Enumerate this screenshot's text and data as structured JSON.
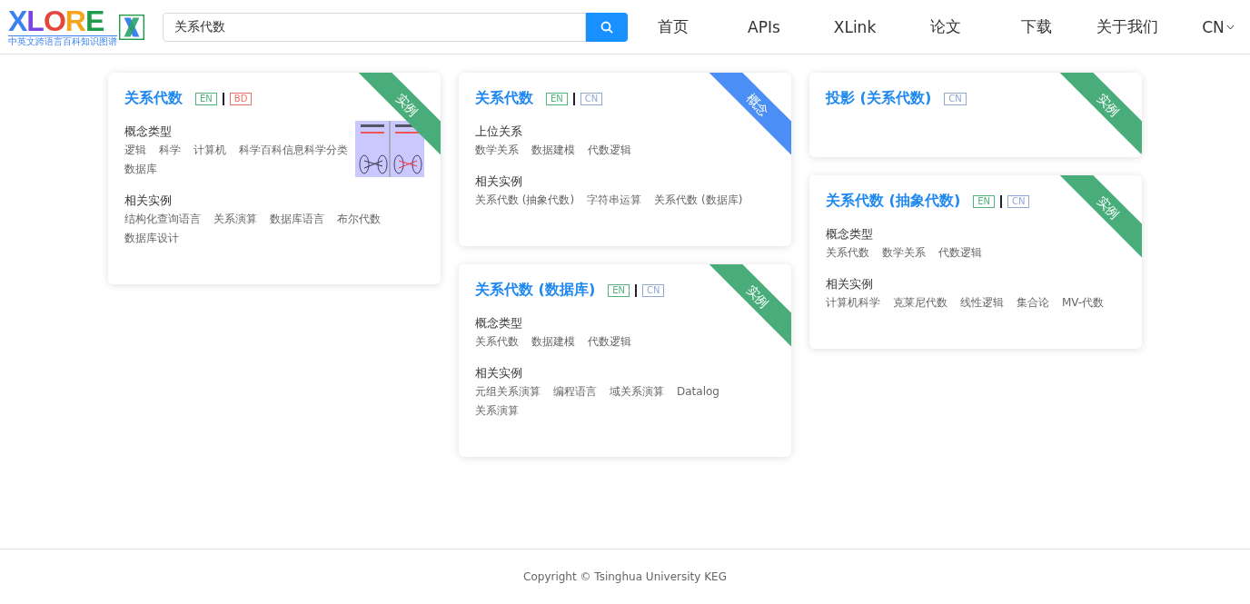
{
  "header": {
    "logo": {
      "text": "XLORE",
      "subtitle": "中英文跨语言百科知识图谱"
    },
    "search": {
      "value": "关系代数"
    },
    "nav": [
      {
        "label": "首页"
      },
      {
        "label": "APIs"
      },
      {
        "label": "XLink"
      },
      {
        "label": "论文"
      },
      {
        "label": "下载"
      },
      {
        "label": "关于我们"
      },
      {
        "label": "CN",
        "kind": "dropdown"
      }
    ]
  },
  "columns": [
    [
      {
        "title": "关系代数",
        "tags": [
          {
            "label": "EN",
            "color": "#52b47a"
          },
          {
            "label": "BD",
            "color": "#e8706a"
          }
        ],
        "ribbon": {
          "label": "实例",
          "color": "#48ad7a"
        },
        "image": {
          "kind": "picture"
        },
        "sections": [
          {
            "heading": "概念类型",
            "items": [
              "逻辑",
              "科学",
              "计算机",
              "科学百科信息科学分类",
              "数据库"
            ]
          },
          {
            "heading": "相关实例",
            "items": [
              "结构化查询语言",
              "关系演算",
              "数据库语言",
              "布尔代数",
              "数据库设计"
            ]
          }
        ]
      }
    ],
    [
      {
        "title": "关系代数",
        "tags": [
          {
            "label": "EN",
            "color": "#52b47a"
          },
          {
            "label": "CN",
            "color": "#8fa7d6"
          }
        ],
        "ribbon": {
          "label": "概念",
          "color": "#4b8ef5"
        },
        "sections": [
          {
            "heading": "上位关系",
            "items": [
              "数学关系",
              "数据建模",
              "代数逻辑"
            ]
          },
          {
            "heading": "相关实例",
            "items": [
              "关系代数 (抽象代数)",
              "字符串运算",
              "关系代数 (数据库)"
            ]
          }
        ]
      },
      {
        "title": "关系代数 (数据库)",
        "tags": [
          {
            "label": "EN",
            "color": "#52b47a"
          },
          {
            "label": "CN",
            "color": "#8fa7d6"
          }
        ],
        "ribbon": {
          "label": "实例",
          "color": "#48ad7a"
        },
        "sections": [
          {
            "heading": "概念类型",
            "items": [
              "关系代数",
              "数据建模",
              "代数逻辑"
            ]
          },
          {
            "heading": "相关实例",
            "items": [
              "元组关系演算",
              "编程语言",
              "域关系演算",
              "Datalog",
              "关系演算"
            ]
          }
        ]
      }
    ],
    [
      {
        "title": "投影 (关系代数)",
        "tags": [
          {
            "label": "CN",
            "color": "#8fa7d6"
          }
        ],
        "ribbon": {
          "label": "实例",
          "color": "#48ad7a"
        }
      },
      {
        "title": "关系代数 (抽象代数)",
        "tags": [
          {
            "label": "EN",
            "color": "#52b47a"
          },
          {
            "label": "CN",
            "color": "#8fa7d6"
          }
        ],
        "ribbon": {
          "label": "实例",
          "color": "#48ad7a"
        },
        "sections": [
          {
            "heading": "概念类型",
            "items": [
              "关系代数",
              "数学关系",
              "代数逻辑"
            ]
          },
          {
            "heading": "相关实例",
            "items": [
              "计算机科学",
              "克莱尼代数",
              "线性逻辑",
              "集合论",
              "MV-代数"
            ]
          }
        ]
      }
    ]
  ],
  "footer": {
    "text": "Copyright © Tsinghua University KEG"
  }
}
